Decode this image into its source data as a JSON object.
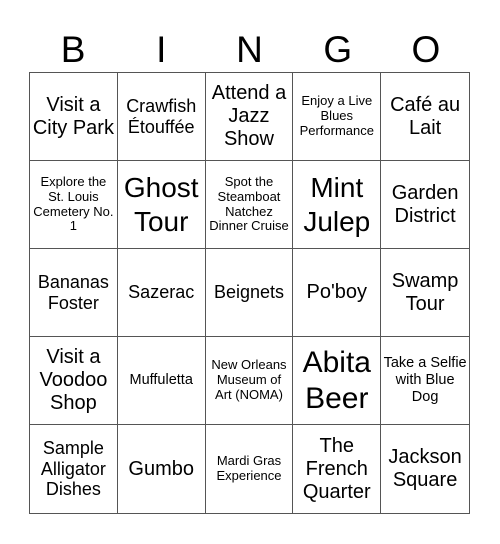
{
  "header": {
    "letters": [
      "B",
      "I",
      "N",
      "G",
      "O"
    ]
  },
  "cells": [
    "Visit a City Park",
    "Crawfish Étouffée",
    "Attend a Jazz Show",
    "Enjoy a Live Blues Performance",
    "Café au Lait",
    "Explore the St. Louis Cemetery No. 1",
    "Ghost Tour",
    "Spot the Steamboat Natchez Dinner Cruise",
    "Mint Julep",
    "Garden District",
    "Bananas Foster",
    "Sazerac",
    "Beignets",
    "Po'boy",
    "Swamp Tour",
    "Visit a Voodoo Shop",
    "Muffuletta",
    "New Orleans Museum of Art (NOMA)",
    "Abita Beer",
    "Take a Selfie with Blue Dog",
    "Sample Alligator Dishes",
    "Gumbo",
    "Mardi Gras Experience",
    "The French Quarter",
    "Jackson Square"
  ]
}
